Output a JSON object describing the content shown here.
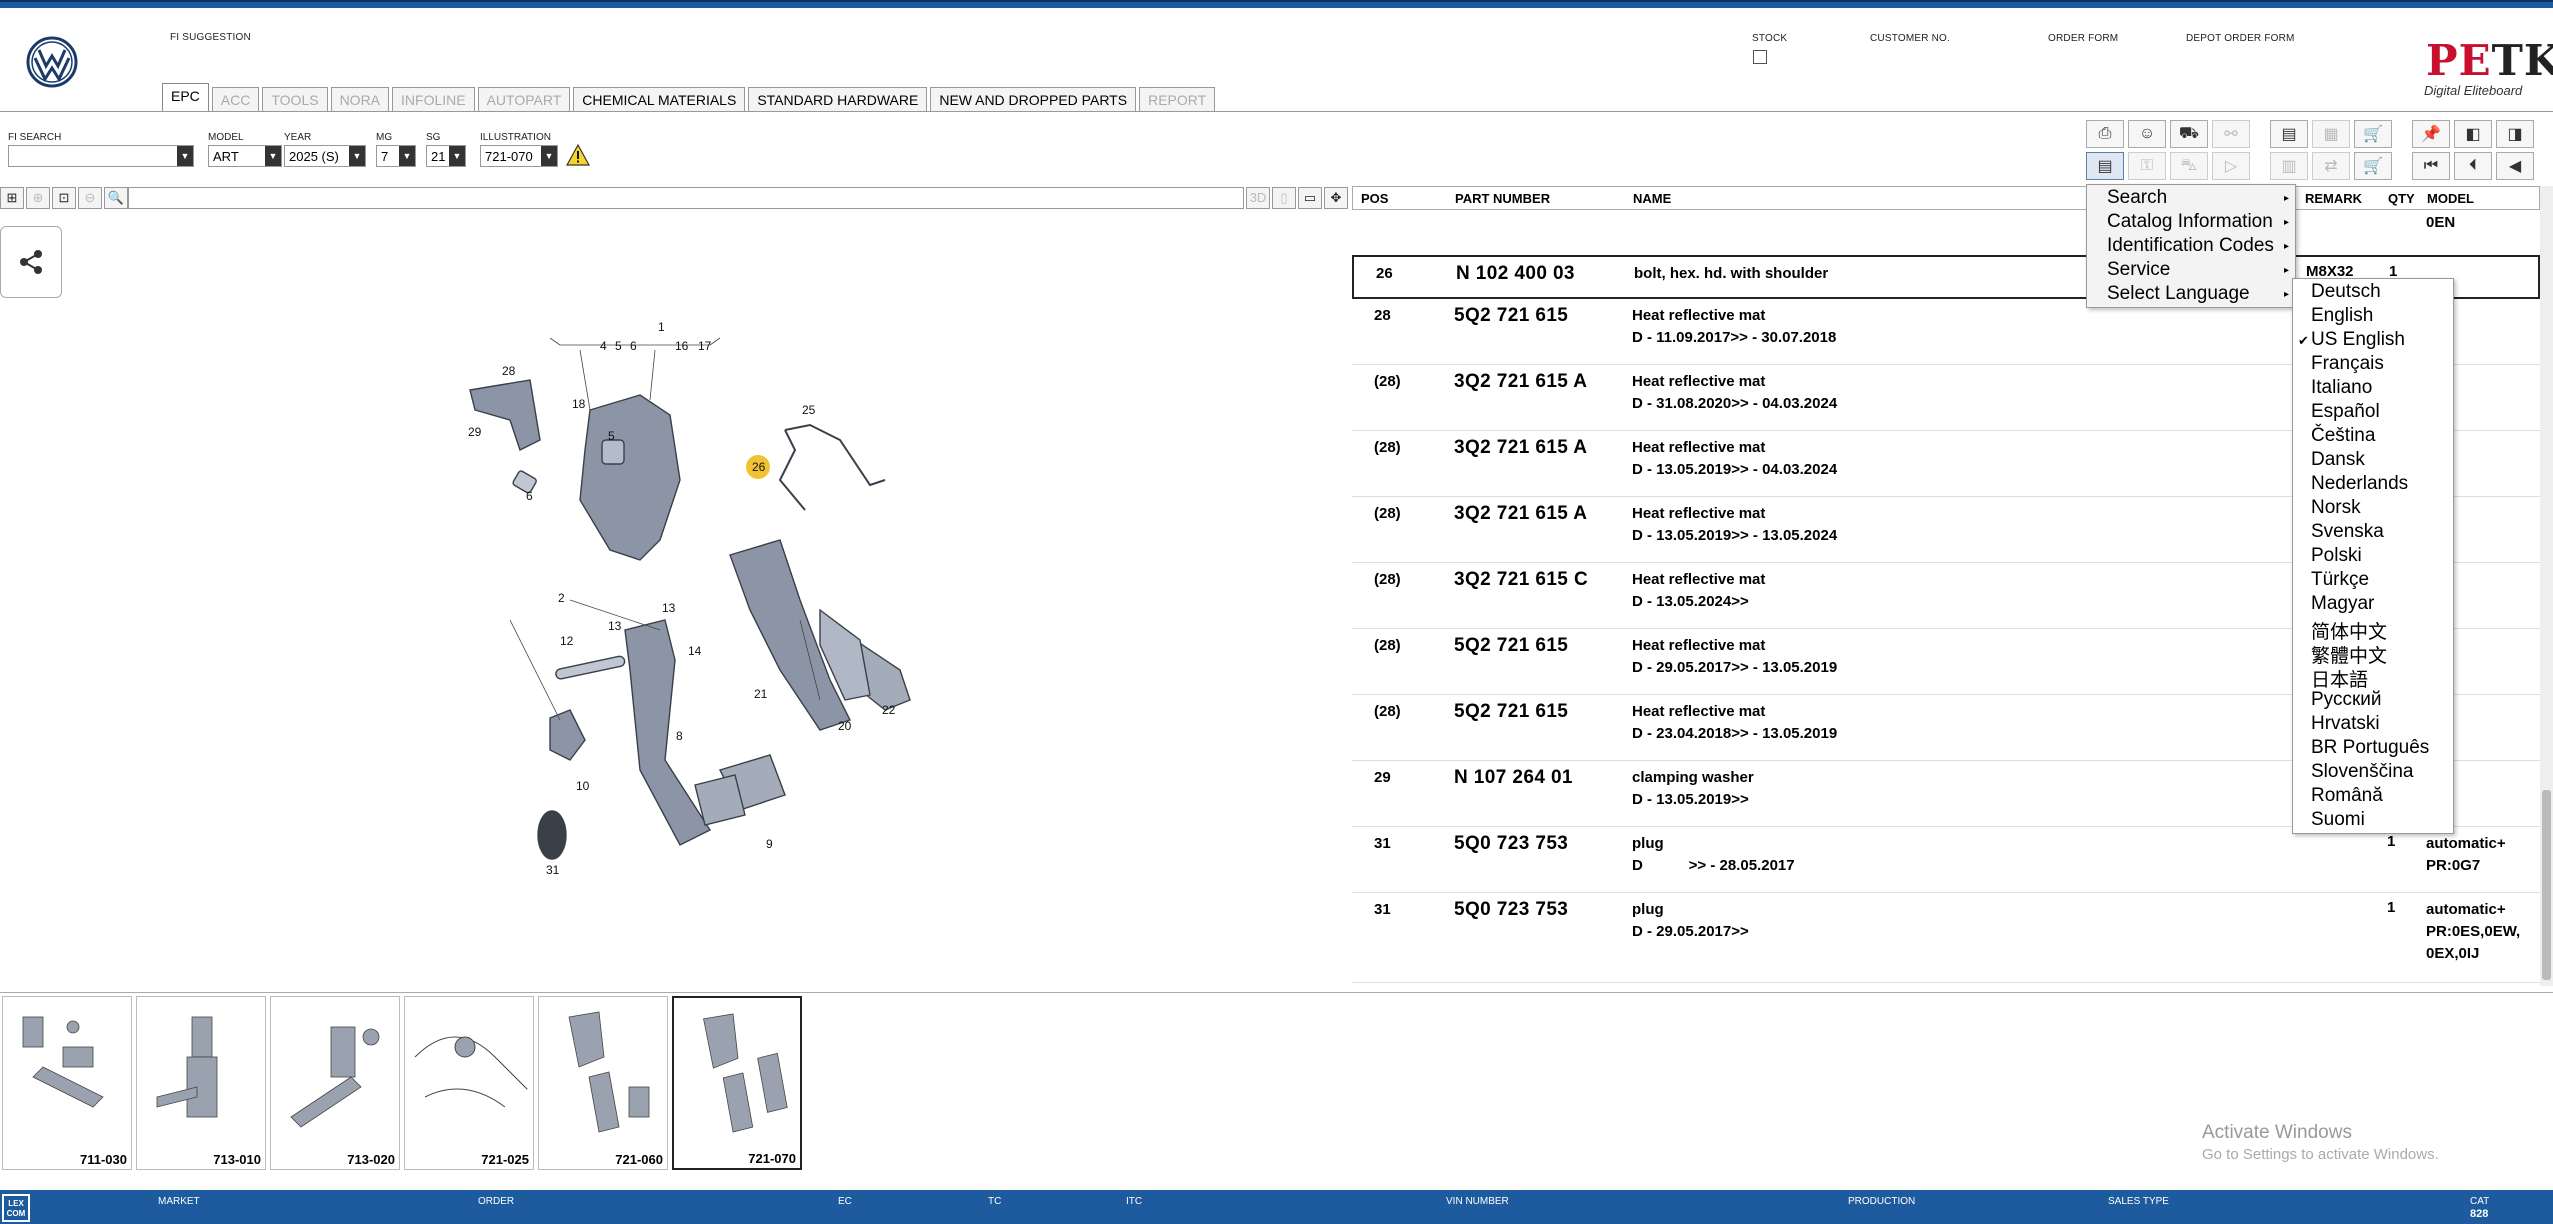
{
  "header": {
    "fi_suggestion_label": "FI SUGGESTION",
    "stock_label": "STOCK",
    "customer_no_label": "CUSTOMER NO.",
    "order_form_label": "ORDER FORM",
    "depot_order_form_label": "DEPOT ORDER FORM",
    "brand_pe": "PE",
    "brand_tka": "TKA",
    "brand_sub": "Digital Eliteboard"
  },
  "tabs": [
    {
      "label": "EPC",
      "active": true
    },
    {
      "label": "ACC"
    },
    {
      "label": "TOOLS"
    },
    {
      "label": "NORA"
    },
    {
      "label": "INFOLINE"
    },
    {
      "label": "AUTOPART"
    },
    {
      "label": "CHEMICAL MATERIALS"
    },
    {
      "label": "STANDARD HARDWARE"
    },
    {
      "label": "NEW AND DROPPED PARTS"
    },
    {
      "label": "REPORT"
    }
  ],
  "selectors": {
    "fi_search_label": "FI SEARCH",
    "model_label": "MODEL",
    "model_value": "ART",
    "year_label": "YEAR",
    "year_value": "2025 (S)",
    "mg_label": "MG",
    "mg_value": "7",
    "sg_label": "SG",
    "sg_value": "21",
    "illustration_label": "ILLUSTRATION",
    "illustration_value": "721-070"
  },
  "zoom_toolbar": {
    "btn_3d": "3D"
  },
  "table": {
    "headers": {
      "pos": "POS",
      "part_number": "PART NUMBER",
      "name": "NAME",
      "remark": "REMARK",
      "qty": "QTY",
      "model": "MODEL"
    },
    "header_model_extra": "0EN",
    "rows": [
      {
        "pos": "26",
        "pn": "N  102 400 03",
        "name": "bolt, hex. hd. with shoulder",
        "remark": "M8X32",
        "qty": "1",
        "model": ""
      },
      {
        "pos": "28",
        "pn": "5Q2 721 615",
        "name": "Heat reflective mat\nD - 11.09.2017>> - 30.07.2018",
        "remark": "",
        "qty": "",
        "model": ""
      },
      {
        "pos": "(28)",
        "pn": "3Q2 721 615 A",
        "name": "Heat reflective mat\nD - 31.08.2020>> - 04.03.2024",
        "remark": "",
        "qty": "",
        "model": ""
      },
      {
        "pos": "(28)",
        "pn": "3Q2 721 615 A",
        "name": "Heat reflective mat\nD - 13.05.2019>> - 04.03.2024",
        "remark": "",
        "qty": "",
        "model": ""
      },
      {
        "pos": "(28)",
        "pn": "3Q2 721 615 A",
        "name": "Heat reflective mat\nD - 13.05.2019>> - 13.05.2024",
        "remark": "",
        "qty": "",
        "model": ""
      },
      {
        "pos": "(28)",
        "pn": "3Q2 721 615 C",
        "name": "Heat reflective mat\nD - 13.05.2024>>",
        "remark": "",
        "qty": "",
        "model": ""
      },
      {
        "pos": "(28)",
        "pn": "5Q2 721 615",
        "name": "Heat reflective mat\nD - 29.05.2017>> - 13.05.2019",
        "remark": "",
        "qty": "",
        "model": ""
      },
      {
        "pos": "(28)",
        "pn": "5Q2 721 615",
        "name": "Heat reflective mat\nD - 23.04.2018>> - 13.05.2019",
        "remark": "",
        "qty": "",
        "model": ""
      },
      {
        "pos": "29",
        "pn": "N  107 264 01",
        "name": "clamping washer\nD - 13.05.2019>>",
        "remark": "",
        "qty": "",
        "model": ""
      },
      {
        "pos": "31",
        "pn": "5Q0 723 753",
        "name": "plug\nD           >> - 28.05.2017",
        "remark": "",
        "qty": "1",
        "model": "automatic+\nPR:0G7"
      },
      {
        "pos": "31",
        "pn": "5Q0 723 753",
        "name": "plug\nD - 29.05.2017>>",
        "remark": "",
        "qty": "1",
        "model": "automatic+\nPR:0ES,0EW,\n0EX,0IJ"
      }
    ]
  },
  "context_menu": {
    "items": [
      "Search",
      "Catalog Information",
      "Identification Codes",
      "Service",
      "Select Language"
    ]
  },
  "language_menu": {
    "selected": "US English",
    "items": [
      "Deutsch",
      "English",
      "US English",
      "Français",
      "Italiano",
      "Español",
      "Čeština",
      "Dansk",
      "Nederlands",
      "Norsk",
      "Svenska",
      "Polski",
      "Türkçe",
      "Magyar",
      "简体中文",
      "繁體中文",
      "日本語",
      "Русский",
      "Hrvatski",
      "BR Português",
      "Slovenščina",
      "Română",
      "Suomi"
    ]
  },
  "diagram": {
    "callouts": [
      "1",
      "4",
      "5",
      "6",
      "16",
      "17",
      "28",
      "18",
      "29",
      "25",
      "26",
      "5",
      "6",
      "2",
      "13",
      "13",
      "12",
      "14",
      "8",
      "10",
      "21",
      "22",
      "20",
      "9",
      "31"
    ]
  },
  "thumbnails": [
    "711-030",
    "713-010",
    "713-020",
    "721-025",
    "721-060",
    "721-070"
  ],
  "watermark": {
    "line1": "Activate Windows",
    "line2": "Go to Settings to activate Windows."
  },
  "footer": {
    "logo_text": "LEX\nCOM",
    "labels": [
      "MARKET",
      "ORDER",
      "EC",
      "TC",
      "ITC",
      "VIN NUMBER",
      "PRODUCTION",
      "SALES TYPE",
      "CAT"
    ],
    "cat_value": "828"
  },
  "colors": {
    "brand_blue": "#1d5a9e",
    "petka_red": "#c8102e",
    "highlight_yellow": "#f3c232"
  }
}
